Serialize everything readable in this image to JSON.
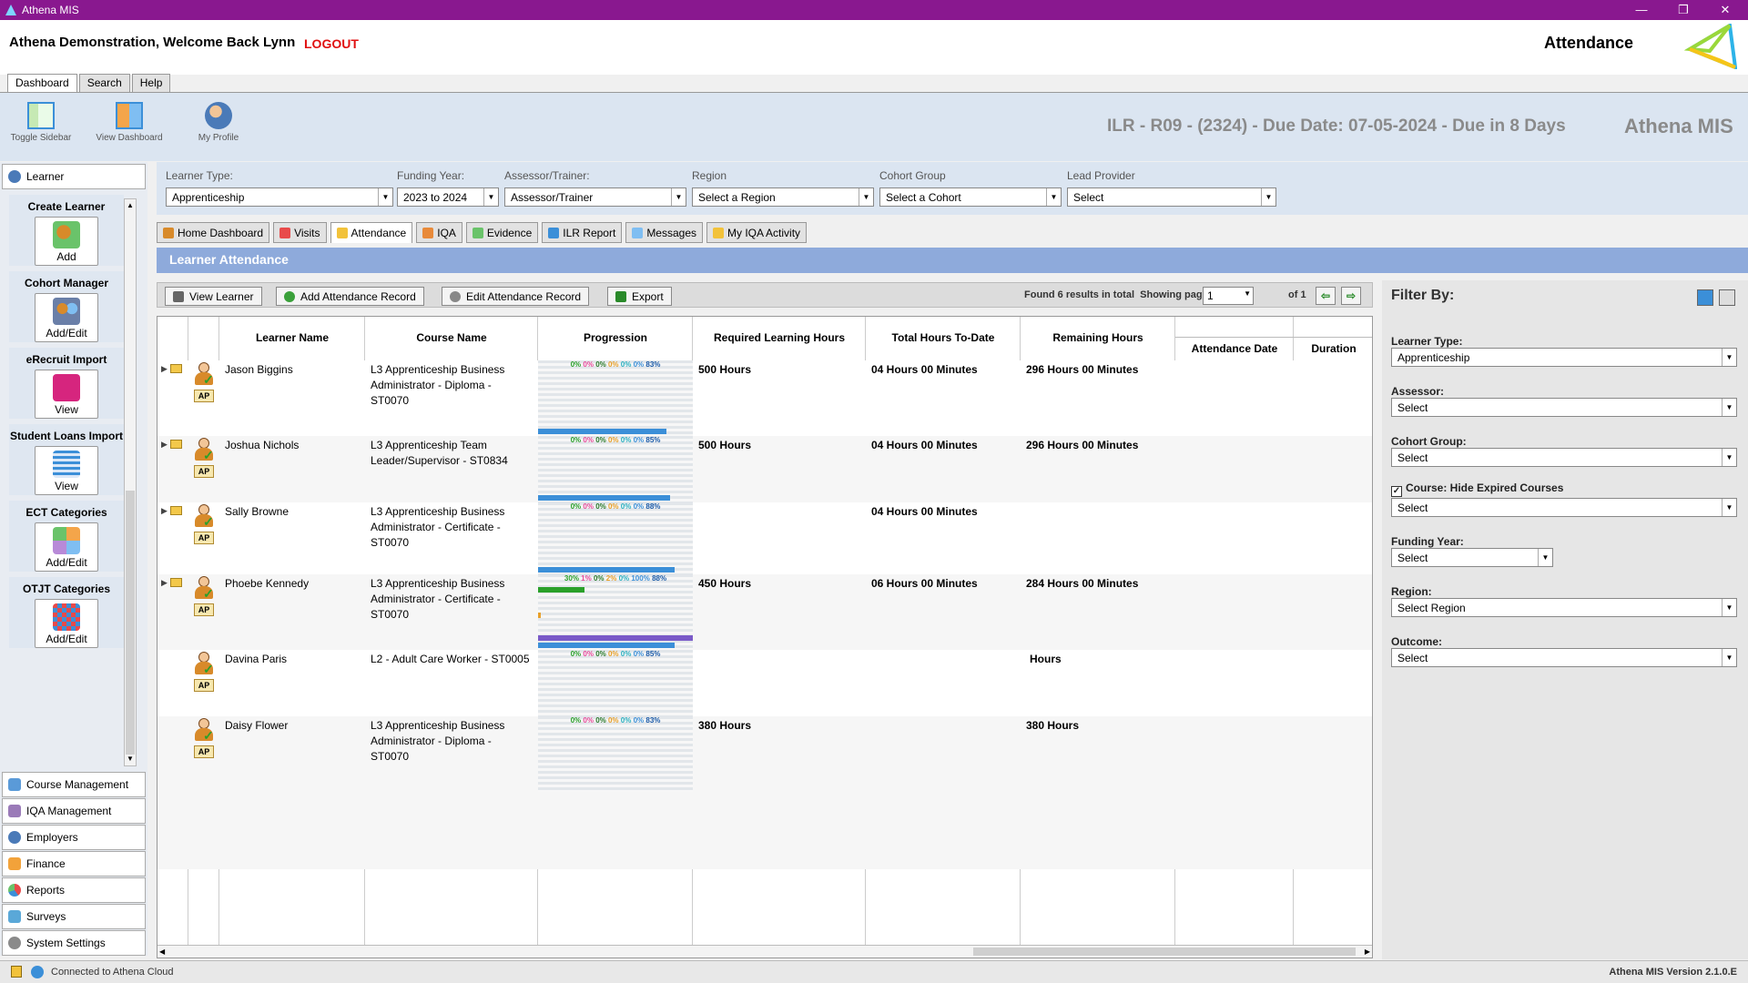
{
  "window": {
    "title": "Athena MIS",
    "minimize": "—",
    "restore": "❐",
    "close": "✕"
  },
  "header": {
    "welcome": "Athena Demonstration,  Welcome Back Lynn",
    "logout": "LOGOUT",
    "page_title": "Attendance"
  },
  "menu_tabs": [
    "Dashboard",
    "Search",
    "Help"
  ],
  "toolbar": {
    "toggle_sidebar": "Toggle Sidebar",
    "view_dashboard": "View Dashboard",
    "my_profile": "My Profile",
    "ilr": "ILR - R09 - (2324) - Due Date: 07-05-2024 -  Due in 8 Days",
    "brand": "Athena MIS"
  },
  "sidebar": {
    "learner": "Learner",
    "cards": [
      {
        "title": "Create Learner",
        "button": "Add"
      },
      {
        "title": "Cohort Manager",
        "button": "Add/Edit"
      },
      {
        "title": "eRecruit Import",
        "button": "View"
      },
      {
        "title": "Student Loans Import",
        "button": "View"
      },
      {
        "title": "ECT Categories",
        "button": "Add/Edit"
      },
      {
        "title": "OTJT Categories",
        "button": "Add/Edit"
      }
    ],
    "sections": [
      "Course Management",
      "IQA Management",
      "Employers",
      "Finance",
      "Reports",
      "Surveys",
      "System Settings"
    ]
  },
  "filters": {
    "learner_type": {
      "label": "Learner Type:",
      "value": "Apprenticeship"
    },
    "funding_year": {
      "label": "Funding Year:",
      "value": "2023 to 2024"
    },
    "assessor": {
      "label": "Assessor/Trainer:",
      "value": "Assessor/Trainer"
    },
    "region": {
      "label": "Region",
      "value": "Select a Region"
    },
    "cohort": {
      "label": "Cohort Group",
      "value": "Select a Cohort"
    },
    "lead_provider": {
      "label": "Lead Provider",
      "value": "Select"
    }
  },
  "tabs": [
    "Home Dashboard",
    "Visits",
    "Attendance",
    "IQA",
    "Evidence",
    "ILR Report",
    "Messages",
    "My IQA Activity"
  ],
  "panel": {
    "title": "Learner Attendance"
  },
  "actions": {
    "view_learner": "View Learner",
    "add_record": "Add Attendance Record",
    "edit_record": "Edit Attendance Record",
    "export": "Export",
    "found": "Found 6 results in total",
    "showing": "Showing page",
    "page": "1",
    "of": "of 1"
  },
  "grid": {
    "columns": [
      "Learner Name",
      "Course Name",
      "Progression",
      "Required Learning Hours",
      "Total Hours To-Date",
      "Remaining Hours",
      "Attendance Date",
      "Duration"
    ],
    "rows": [
      {
        "name": "Jason Biggins",
        "course": [
          "L3 Apprenticeship Business",
          "Administrator - Diploma -",
          "ST0070"
        ],
        "prog": [
          "0%",
          "0%",
          "0%",
          "0%",
          "0%",
          "0%",
          "83%"
        ],
        "req": "500 Hours",
        "total": "04 Hours 00 Minutes",
        "remaining": "296 Hours 00 Minutes",
        "badge": "AP",
        "bar": 0.83
      },
      {
        "name": "Joshua Nichols",
        "course": [
          "L3 Apprenticeship Team",
          "Leader/Supervisor - ST0834",
          ""
        ],
        "prog": [
          "0%",
          "0%",
          "0%",
          "0%",
          "0%",
          "0%",
          "85%"
        ],
        "req": "500 Hours",
        "total": "04 Hours 00 Minutes",
        "remaining": "296 Hours 00 Minutes",
        "badge": "AP",
        "bar": 0.85
      },
      {
        "name": "Sally Browne",
        "course": [
          "L3 Apprenticeship Business",
          "Administrator - Certificate -",
          "ST0070"
        ],
        "prog": [
          "0%",
          "0%",
          "0%",
          "0%",
          "0%",
          "0%",
          "88%"
        ],
        "req": "",
        "total": "04 Hours 00 Minutes",
        "remaining": "",
        "badge": "AP",
        "bar": 0.88
      },
      {
        "name": "Phoebe Kennedy",
        "course": [
          "L3 Apprenticeship Business",
          "Administrator - Certificate -",
          "ST0070"
        ],
        "prog": [
          "30%",
          "1%",
          "0%",
          "2%",
          "0%",
          "100%",
          "88%"
        ],
        "req": "450 Hours",
        "total": "06 Hours 00 Minutes",
        "remaining": "284 Hours 00 Minutes",
        "badge": "AP",
        "bar": 0.88
      },
      {
        "name": "Davina Paris",
        "course": [
          "L2 - Adult Care Worker - ST0005",
          "",
          ""
        ],
        "prog": [
          "0%",
          "0%",
          "0%",
          "0%",
          "0%",
          "0%",
          "85%"
        ],
        "req": "",
        "total": "",
        "remaining": "Hours",
        "badge": "AP",
        "bar": 0
      },
      {
        "name": "Daisy Flower",
        "course": [
          "L3 Apprenticeship Business",
          "Administrator - Diploma -",
          "ST0070"
        ],
        "prog": [
          "0%",
          "0%",
          "0%",
          "0%",
          "0%",
          "0%",
          "83%"
        ],
        "req": "380 Hours",
        "total": "",
        "remaining": "380 Hours",
        "badge": "AP",
        "bar": 0
      }
    ]
  },
  "right_panel": {
    "title": "Filter By:",
    "learner_type": {
      "label": "Learner Type:",
      "value": "Apprenticeship"
    },
    "assessor": {
      "label": "Assessor:",
      "value": "Select"
    },
    "cohort": {
      "label": "Cohort Group:",
      "value": "Select"
    },
    "course": {
      "label": "Course: Hide Expired Courses",
      "value": "Select",
      "checked": "✓"
    },
    "funding_year": {
      "label": "Funding Year:",
      "value": "Select"
    },
    "region": {
      "label": "Region:",
      "value": "Select Region"
    },
    "outcome": {
      "label": "Outcome:",
      "value": "Select"
    }
  },
  "status": {
    "connection": "Connected to Athena Cloud",
    "version": "Athena MIS Version 2.1.0.E"
  },
  "colors": {
    "titlebar": "#89188f",
    "panel_header": "#8eaadb",
    "logout": "#e01010"
  }
}
